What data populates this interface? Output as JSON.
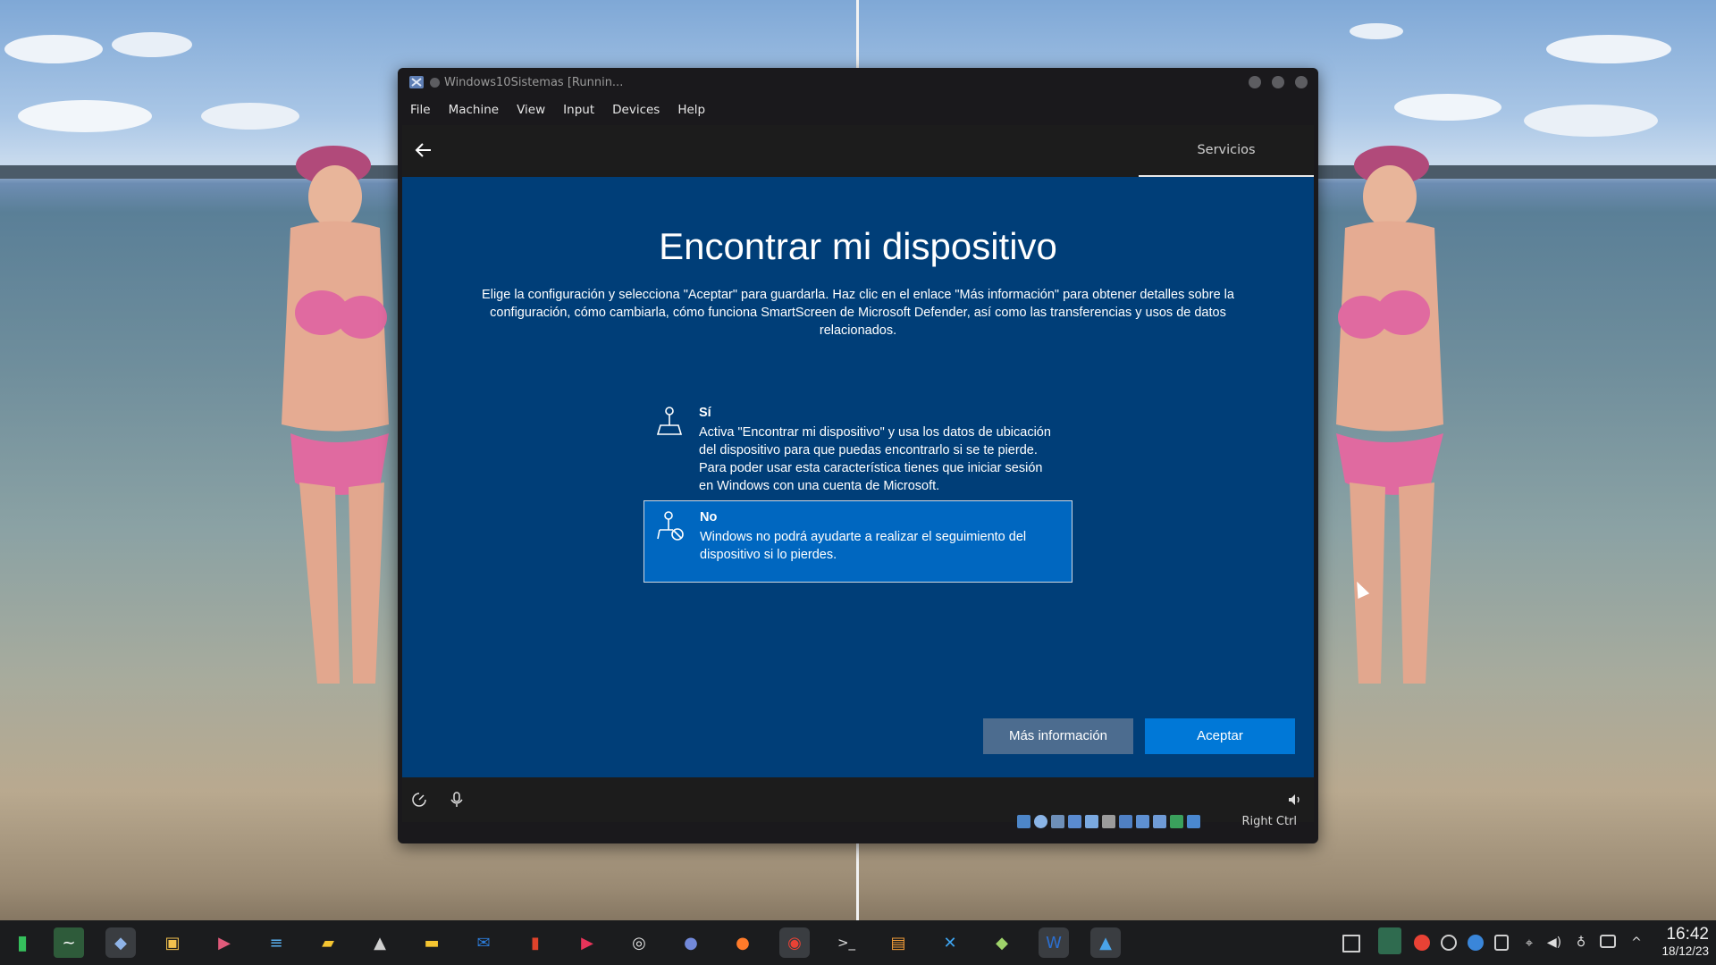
{
  "window": {
    "title": "Windows10Sistemas [Runnin...",
    "menu": [
      "File",
      "Machine",
      "View",
      "Input",
      "Devices",
      "Help"
    ],
    "host_key": "Right Ctrl"
  },
  "oobe": {
    "tab_label": "Servicios",
    "title": "Encontrar mi dispositivo",
    "description": "Elige la configuración y selecciona \"Aceptar\" para guardarla. Haz clic en el enlace \"Más información\" para obtener detalles sobre la configuración, cómo cambiarla, cómo funciona SmartScreen de Microsoft Defender, así como las transferencias y usos de datos relacionados.",
    "options": [
      {
        "title": "Sí",
        "text": "Activa \"Encontrar mi dispositivo\" y usa los datos de ubicación del dispositivo para que puedas encontrarlo si se te pierde. Para poder usar esta característica tienes que iniciar sesión en Windows con una cuenta de Microsoft.",
        "selected": false
      },
      {
        "title": "No",
        "text": "Windows no podrá ayudarte a realizar el seguimiento del dispositivo si lo pierdes.",
        "selected": true
      }
    ],
    "more_info_button": "Más información",
    "accept_button": "Aceptar"
  },
  "clock": {
    "time": "16:42",
    "date": "18/12/23"
  },
  "colors": {
    "oobe_blue": "#003e78",
    "selected_option": "#0067c0",
    "accept": "#0078d7"
  }
}
